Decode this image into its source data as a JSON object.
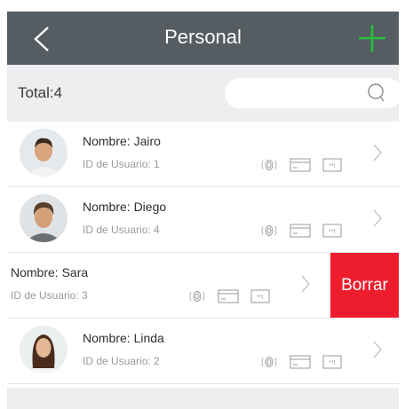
{
  "header": {
    "title": "Personal"
  },
  "toolbar": {
    "total_label": "Total:4",
    "search_placeholder": ""
  },
  "colors": {
    "header_bg": "#565d62",
    "add_icon": "#22c03a",
    "delete_bg": "#ee1d2d"
  },
  "users": [
    {
      "name": "Nombre: Jairo",
      "user_id": "ID de Usuario: 1"
    },
    {
      "name": "Nombre: Diego",
      "user_id": "ID de Usuario: 4"
    },
    {
      "name": "Nombre: Sara",
      "user_id": "ID de Usuario: 3",
      "swiped": true,
      "delete_label": "Borrar"
    },
    {
      "name": "Nombre: Linda",
      "user_id": "ID de Usuario: 2"
    }
  ],
  "icons": [
    "back-arrow-icon",
    "add-plus-icon",
    "search-icon",
    "fingerprint-icon",
    "card-icon",
    "password-icon",
    "chevron-right-icon"
  ]
}
